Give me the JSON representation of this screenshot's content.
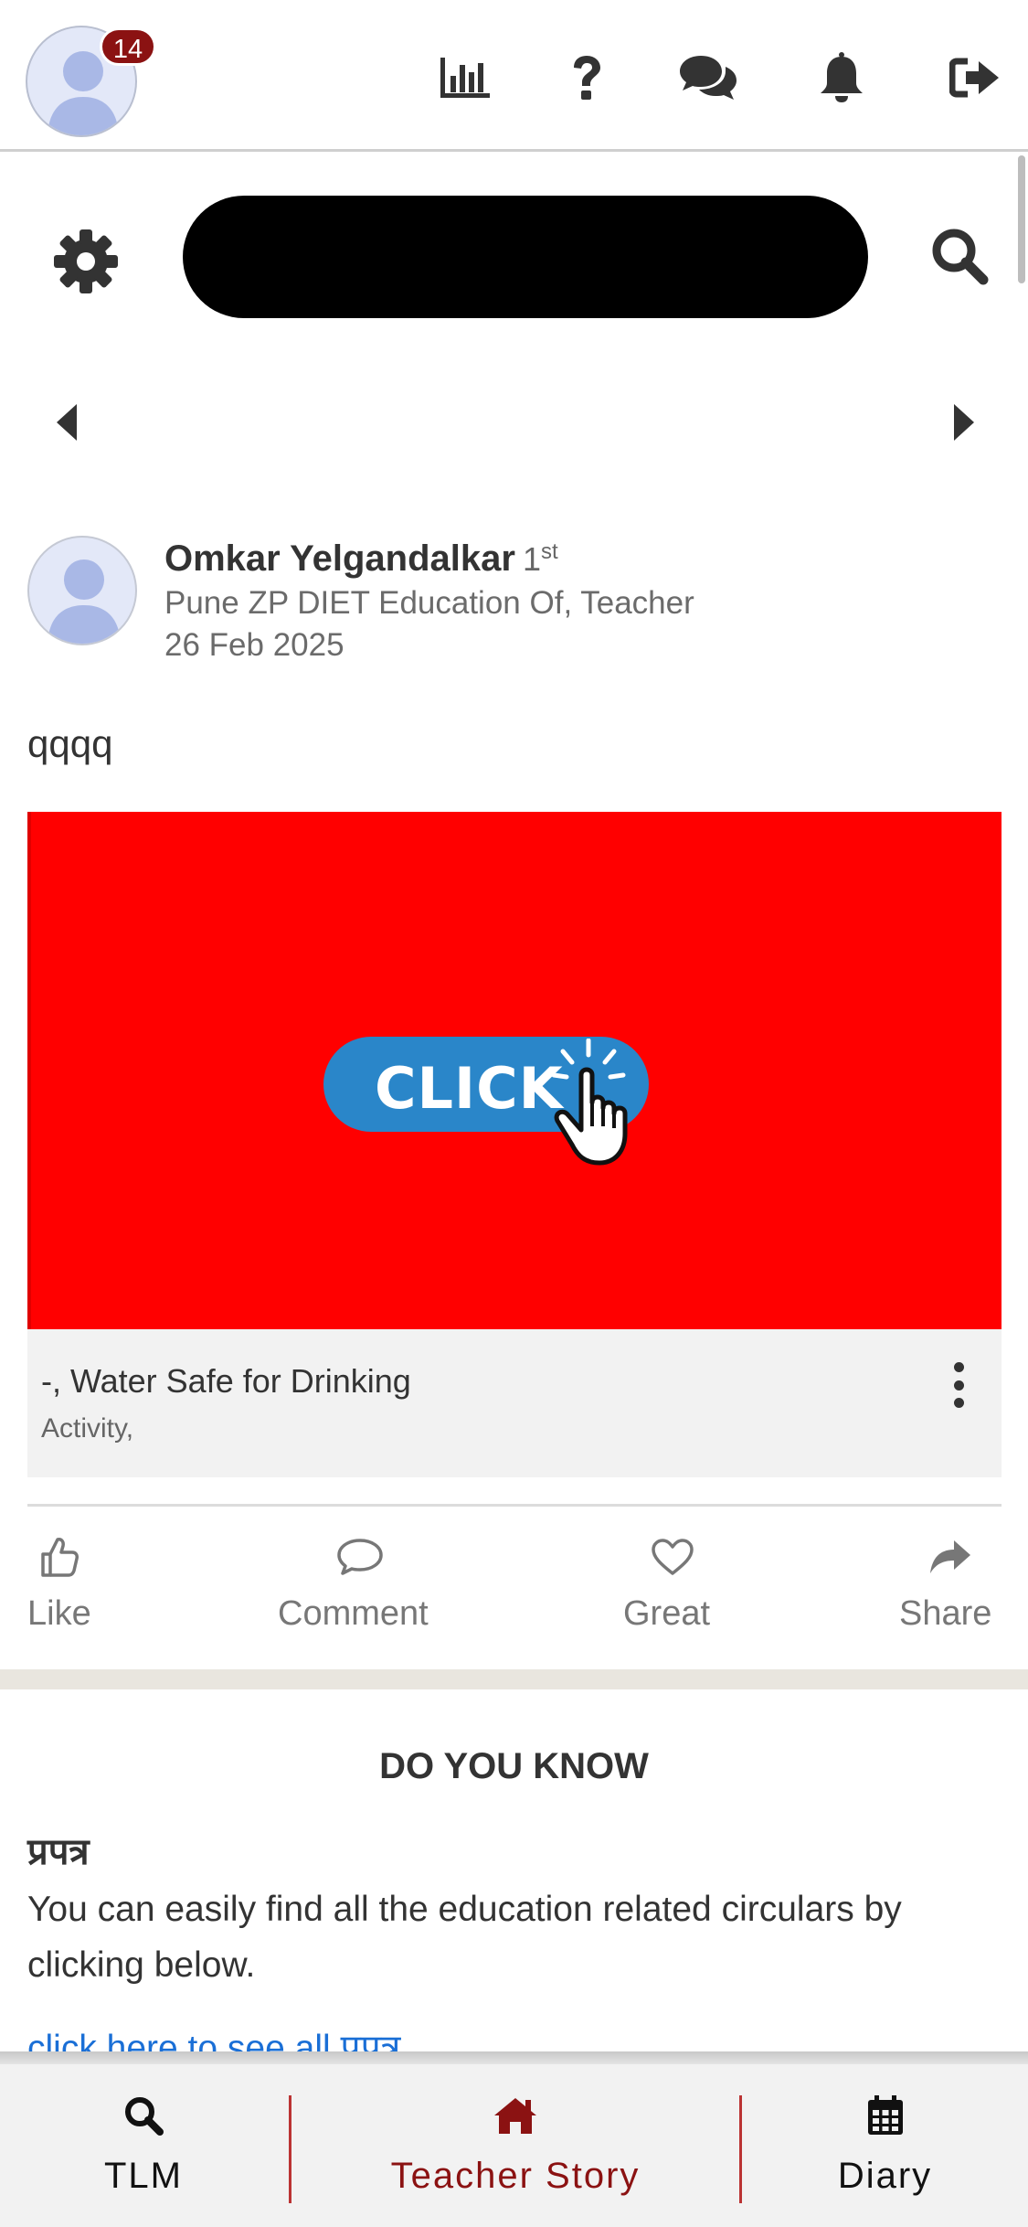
{
  "header": {
    "notification_count": "14",
    "icons": [
      "bar-chart-icon",
      "question-icon",
      "chat-icon",
      "bell-icon",
      "logout-icon"
    ]
  },
  "search": {
    "placeholder": "",
    "value": ""
  },
  "post": {
    "author": "Omkar Yelgandalkar",
    "degree": "1",
    "degree_suffix": "st",
    "role": "Pune ZP DIET Education Of, Teacher",
    "date": "26 Feb 2025",
    "text": "qqqq",
    "media_button_label": "CLICK",
    "media_bg_color": "#ff0000",
    "caption_title": "-, Water Safe for Drinking",
    "caption_sub": "Activity,",
    "actions": {
      "like": "Like",
      "comment": "Comment",
      "great": "Great",
      "share": "Share"
    }
  },
  "did_you_know": {
    "title": "DO YOU KNOW",
    "heading": "प्रपत्र",
    "body": "You can easily find all the education related circulars by clicking below.",
    "link": "click here to see all प्रपत्र"
  },
  "bottom_nav": {
    "items": [
      {
        "label": "TLM",
        "icon": "search-icon"
      },
      {
        "label": "Teacher Story",
        "icon": "home-icon",
        "active": true
      },
      {
        "label": "Diary",
        "icon": "calendar-icon"
      }
    ],
    "active_color": "#8b1212"
  }
}
